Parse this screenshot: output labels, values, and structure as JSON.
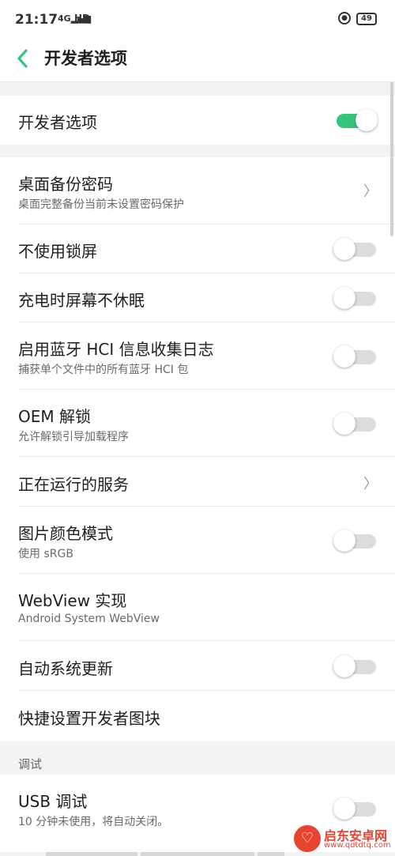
{
  "status_bar": {
    "time": "21:17",
    "network": "4G",
    "signal_glyph": "▂▄▆",
    "hd": "HD",
    "battery": "49"
  },
  "header": {
    "title": "开发者选项"
  },
  "master": {
    "label": "开发者选项",
    "enabled": true
  },
  "items": [
    {
      "title": "桌面备份密码",
      "subtitle": "桌面完整备份当前未设置密码保护",
      "control": "chevron"
    },
    {
      "title": "不使用锁屏",
      "control": "toggle",
      "enabled": false
    },
    {
      "title": "充电时屏幕不休眠",
      "control": "toggle",
      "enabled": false
    },
    {
      "title": "启用蓝牙 HCI 信息收集日志",
      "subtitle": "捕获单个文件中的所有蓝牙 HCI 包",
      "control": "toggle",
      "enabled": false
    },
    {
      "title": "OEM 解锁",
      "subtitle": "允许解锁引导加载程序",
      "control": "toggle",
      "enabled": false
    },
    {
      "title": "正在运行的服务",
      "control": "chevron"
    },
    {
      "title": "图片颜色模式",
      "subtitle": "使用 sRGB",
      "control": "toggle",
      "enabled": false
    },
    {
      "title": "WebView 实现",
      "subtitle": "Android System WebView",
      "control": "none"
    },
    {
      "title": "自动系统更新",
      "control": "toggle",
      "enabled": false
    },
    {
      "title": "快捷设置开发者图块",
      "control": "none"
    }
  ],
  "debug_section": {
    "header": "调试",
    "items": [
      {
        "title": "USB 调试",
        "subtitle": "10 分钟未使用，将自动关闭。",
        "control": "toggle",
        "enabled": false
      }
    ]
  },
  "watermark": {
    "name": "启东安卓网",
    "url": "www.qdtdtq.com"
  },
  "colors": {
    "accent": "#34c47c",
    "background": "#f3f3f3",
    "card": "#ffffff",
    "watermark": "#e8432f"
  },
  "icons": {
    "back": "chevron-left-icon",
    "disclosure": "chevron-right-icon",
    "lock": "rotation-lock-icon",
    "battery": "battery-icon"
  }
}
